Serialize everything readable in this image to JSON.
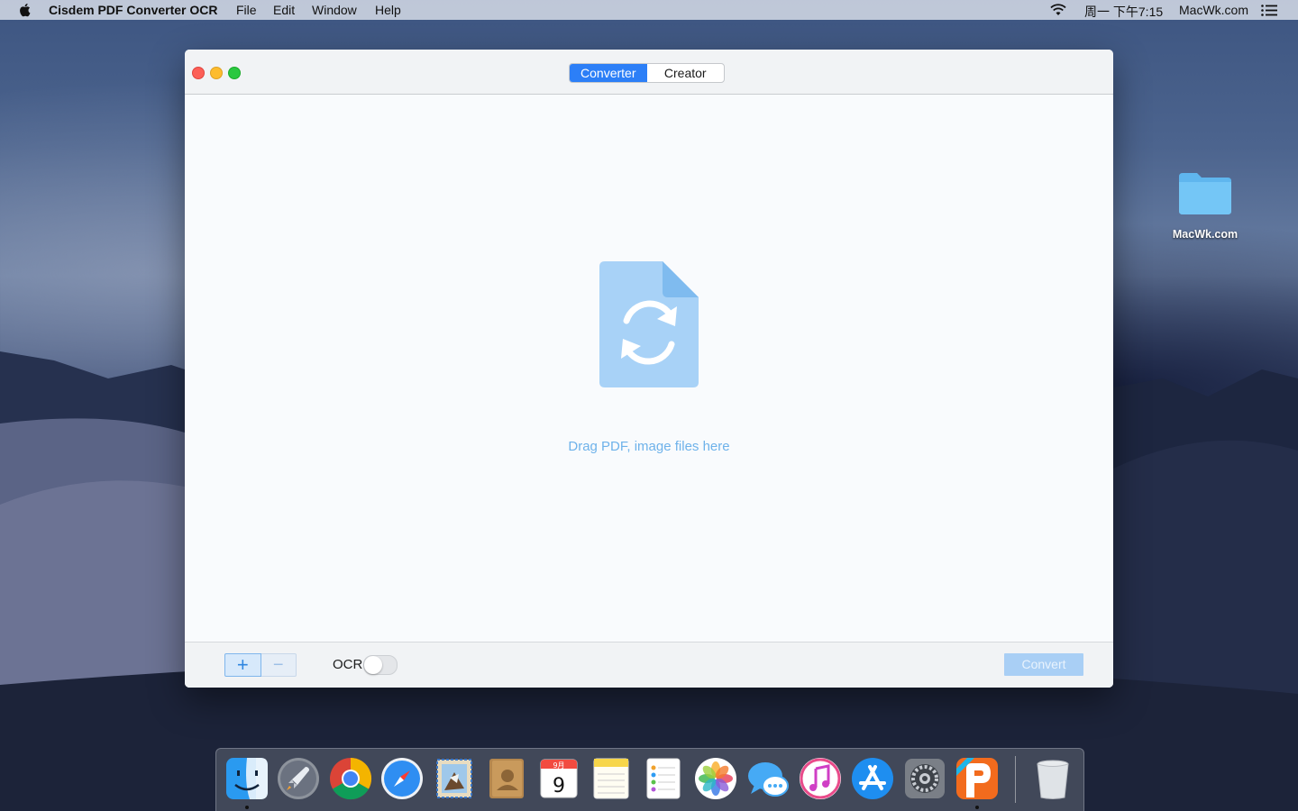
{
  "menubar": {
    "app_name": "Cisdem PDF Converter OCR",
    "menus": [
      "File",
      "Edit",
      "Window",
      "Help"
    ],
    "clock": "周一 下午7:15",
    "site": "MacWk.com"
  },
  "window": {
    "tabs": [
      {
        "label": "Converter",
        "active": true
      },
      {
        "label": "Creator",
        "active": false
      }
    ],
    "drop_hint": "Drag PDF, image files here",
    "bottom": {
      "add_label": "+",
      "remove_label": "−",
      "ocr_label": "OCR",
      "ocr_enabled": false,
      "convert_label": "Convert"
    }
  },
  "desktop": {
    "folder_label": "MacWk.com"
  },
  "dock": {
    "items": [
      {
        "name": "finder-icon",
        "running": true
      },
      {
        "name": "launchpad-icon",
        "running": false
      },
      {
        "name": "chrome-icon",
        "running": false
      },
      {
        "name": "safari-icon",
        "running": false
      },
      {
        "name": "mail-icon",
        "running": false
      },
      {
        "name": "contacts-icon",
        "running": false
      },
      {
        "name": "calendar-icon",
        "running": false
      },
      {
        "name": "notes-icon",
        "running": false
      },
      {
        "name": "reminders-icon",
        "running": false
      },
      {
        "name": "photos-icon",
        "running": false
      },
      {
        "name": "messages-icon",
        "running": false
      },
      {
        "name": "itunes-icon",
        "running": false
      },
      {
        "name": "app-store-icon",
        "running": false
      },
      {
        "name": "system-preferences-icon",
        "running": false
      },
      {
        "name": "cisdem-pdf-converter-icon",
        "running": true
      },
      {
        "name": "trash-icon",
        "running": false
      }
    ],
    "calendar_month": "9月",
    "calendar_day": "9"
  },
  "colors": {
    "accent": "#2c7ff7",
    "drop_text": "#6eb2ea",
    "convert_disabled": "#a9cff5"
  }
}
